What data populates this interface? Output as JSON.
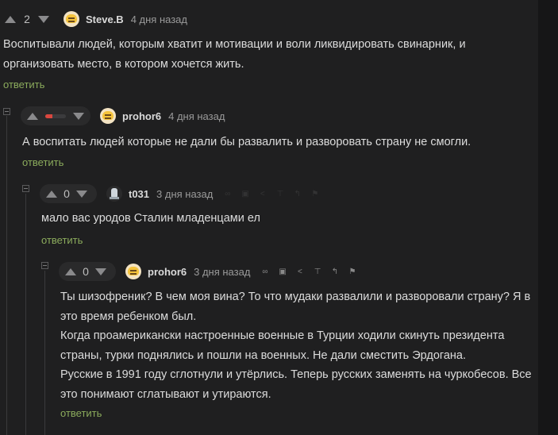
{
  "comments": [
    {
      "score": "2",
      "author": "Steve.B",
      "time": "4 дня назад",
      "lines": [
        "Воспитывали людей, которым хватит и мотивации и воли ликвидировать свинарник, и",
        "организовать место, в котором хочется жить."
      ],
      "reply_label": "ответить"
    },
    {
      "score": "",
      "score_bar": {
        "negative_fraction": 0.35
      },
      "author": "prohor6",
      "time": "4 дня назад",
      "lines": [
        "А воспитать людей которые не дали бы развалить и разворовать страну не смогли."
      ],
      "reply_label": "ответить"
    },
    {
      "score": "0",
      "author": "t031",
      "time": "3 дня назад",
      "lines": [
        "мало вас уродов Сталин младенцами ел"
      ],
      "reply_label": "ответить"
    },
    {
      "score": "0",
      "author": "prohor6",
      "time": "3 дня назад",
      "lines": [
        "Ты шизофреник? В чем моя вина? То что мудаки развалили и разворовали страну? Я в",
        "это время ребенком был.",
        "Когда проамерикански настроенные военные в Турции ходили скинуть президента",
        "страны, турки поднялись и пошли на военных. Не дали сместить Эрдогана.",
        "Русские в 1991 году сглотнули и утёрлись. Теперь русских заменять на чуркобесов. Все",
        "это понимают сглатывают и утираются."
      ],
      "reply_label": "ответить"
    }
  ],
  "icons": [
    "link-icon",
    "save-icon",
    "share-icon",
    "jump-to-parent-icon",
    "branch-icon",
    "report-flag-icon"
  ],
  "colors": {
    "reply_link": "#8bab5c",
    "background": "#1f1f20",
    "negative": "#d9473f"
  }
}
